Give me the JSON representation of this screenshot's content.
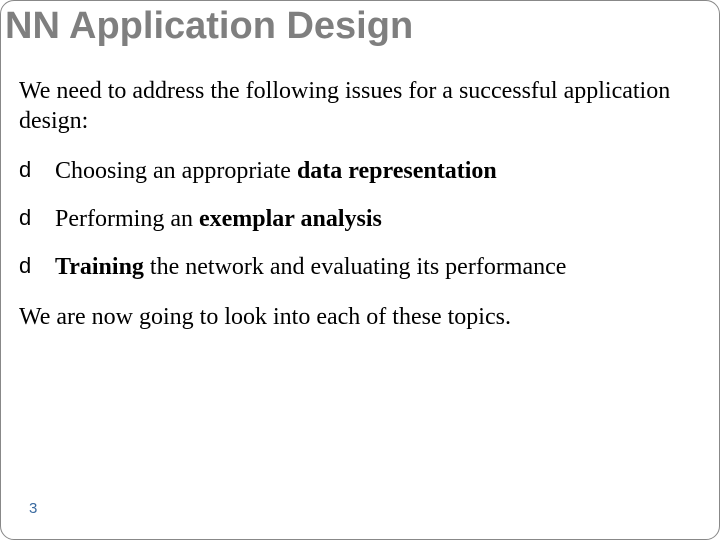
{
  "title": "NN Application Design",
  "intro": "We need to address the following issues for a successful application design:",
  "bullets": [
    {
      "pre": "Choosing an appropriate ",
      "bold": "data representation",
      "post": ""
    },
    {
      "pre": "Performing an ",
      "bold": "exemplar analysis",
      "post": ""
    },
    {
      "pre": "",
      "bold": "Training",
      "post": " the network and evaluating its performance"
    }
  ],
  "outro": "We are now going to look into each of these topics.",
  "bullet_glyph": "d",
  "page_number": "3"
}
